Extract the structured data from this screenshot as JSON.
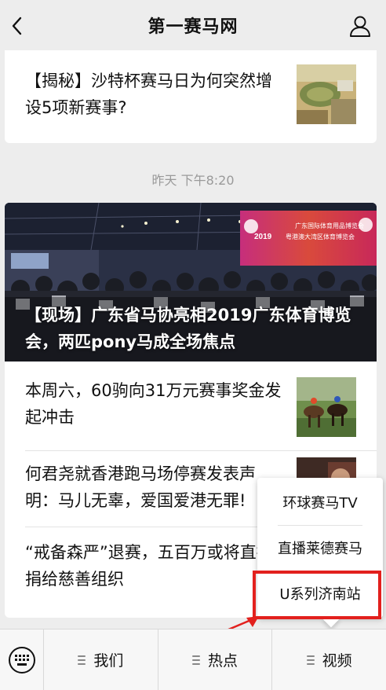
{
  "header": {
    "title": "第一赛马网",
    "back_icon": "chevron-left-icon",
    "profile_icon": "user-icon"
  },
  "articles_top": [
    {
      "title": "【揭秘】沙特杯赛马日为何突然增设5项新赛事?"
    }
  ],
  "timestamp": "昨天 下午8:20",
  "hero": {
    "title": "【现场】广东省马协亮相2019广东体育博览会，两匹pony马成全场焦点",
    "banner_line1": "广东国际体育用品博览会",
    "banner_year": "2019",
    "banner_line2": "粤港澳大湾区体育博览会"
  },
  "articles": [
    {
      "title": "本周六，60驹向31万元赛事奖金发起冲击"
    },
    {
      "title": "何君尧就香港跑马场停赛发表声明：马儿无辜，爱国爱港无罪!"
    },
    {
      "title": "“戒备森严”退赛，五百万或将直接捐给慈善组织"
    }
  ],
  "popup_menu": {
    "items": [
      {
        "label": "环球赛马TV"
      },
      {
        "label": "直播莱德赛马"
      },
      {
        "label": "U系列济南站"
      }
    ],
    "highlighted_index": 2,
    "highlight_color": "#e2201d"
  },
  "bottom_nav": {
    "keyboard_icon": "keyboard-icon",
    "items": [
      {
        "label": "我们"
      },
      {
        "label": "热点"
      },
      {
        "label": "视频"
      }
    ]
  }
}
